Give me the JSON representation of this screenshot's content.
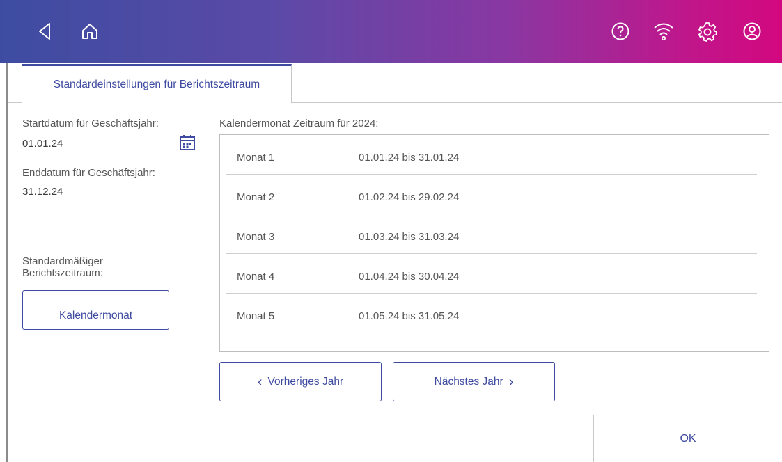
{
  "header": {
    "icons": [
      "back-icon",
      "home-icon",
      "help-icon",
      "wifi-icon",
      "settings-icon",
      "account-icon"
    ]
  },
  "tab": {
    "label": "Standardeinstellungen für Berichtszeitraum"
  },
  "fiscal": {
    "start_label": "Startdatum für Geschäftsjahr:",
    "start_value": "01.01.24",
    "end_label": "Enddatum für Geschäftsjahr:",
    "end_value": "31.12.24",
    "period_label_line1": "Standardmäßiger",
    "period_label_line2": "Berichtszeitraum:",
    "period_button": "Kalendermonat"
  },
  "months": {
    "title": "Kalendermonat Zeitraum für  2024:",
    "rows": [
      {
        "month": "Monat 1",
        "range": "01.01.24  bis  31.01.24"
      },
      {
        "month": "Monat 2",
        "range": "01.02.24  bis  29.02.24"
      },
      {
        "month": "Monat 3",
        "range": "01.03.24  bis  31.03.24"
      },
      {
        "month": "Monat 4",
        "range": "01.04.24  bis  30.04.24"
      },
      {
        "month": "Monat 5",
        "range": "01.05.24  bis  31.05.24"
      }
    ]
  },
  "nav": {
    "prev_label": "Vorheriges Jahr",
    "next_label": "Nächstes Jahr"
  },
  "footer": {
    "ok_label": "OK"
  },
  "colors": {
    "accent": "#3e4ba1",
    "gradient_start": "#3d4ca1",
    "gradient_end": "#d3087f"
  }
}
